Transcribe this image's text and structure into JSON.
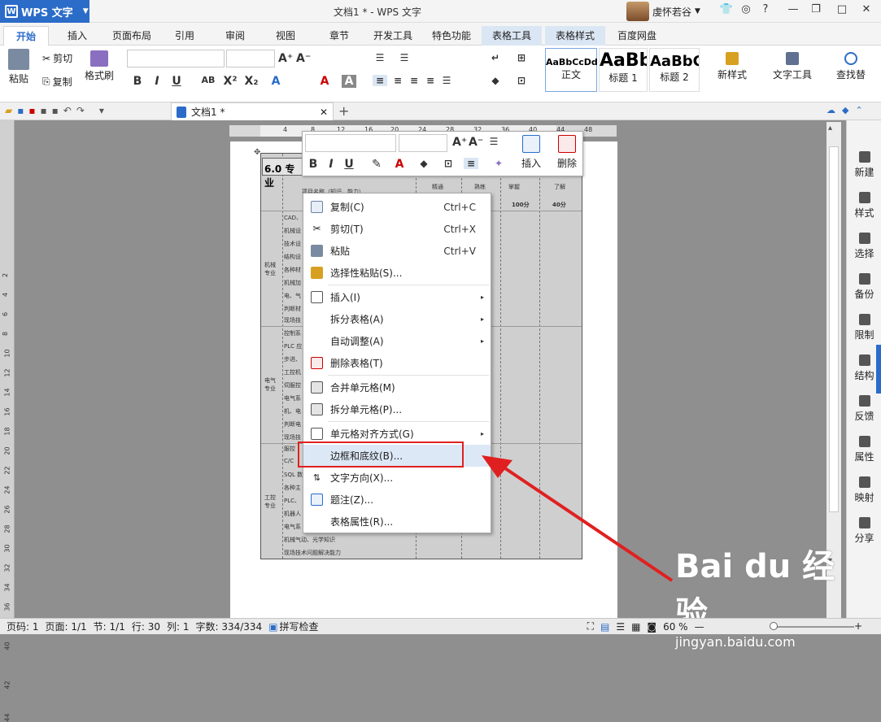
{
  "app": {
    "name": "WPS 文字",
    "title": "文档1 * - WPS 文字",
    "user": "虔怀若谷"
  },
  "tabs": [
    "开始",
    "插入",
    "页面布局",
    "引用",
    "审阅",
    "视图",
    "章节",
    "开发工具",
    "特色功能",
    "表格工具",
    "表格样式",
    "百度网盘"
  ],
  "ribbon": {
    "clipboard": {
      "paste": "粘贴",
      "cut": "剪切",
      "copy": "复制",
      "format_painter": "格式刷"
    },
    "styles": [
      {
        "preview": "AaBbCcDd",
        "label": "正文"
      },
      {
        "preview": "AaBb",
        "label": "标题 1"
      },
      {
        "preview": "AaBbC",
        "label": "标题 2"
      }
    ],
    "new_style": "新样式",
    "text_tools": "文字工具",
    "find_replace": "查找替"
  },
  "doc_tab": {
    "label": "文档1 *"
  },
  "ruler": {
    "h_marks": [
      "4",
      "8",
      "12",
      "16",
      "20",
      "24",
      "28",
      "32",
      "36",
      "40",
      "44",
      "48"
    ],
    "v_marks": [
      "2",
      "4",
      "6",
      "8",
      "10",
      "12",
      "14",
      "16",
      "18",
      "20",
      "22",
      "24",
      "26",
      "28",
      "30",
      "32",
      "34",
      "36",
      "38",
      "40",
      "42",
      "44"
    ]
  },
  "document": {
    "heading": "6.0 专业",
    "header_row": [
      "项目名称（知识、能力）",
      "精通",
      "熟练",
      "掌握",
      "了解"
    ],
    "score_row": [
      "100分",
      "40分"
    ],
    "groups": [
      {
        "name": "机械专业",
        "items": [
          "CAD、",
          "机械设",
          "技术设",
          "结构设",
          "各种材",
          "机械加",
          "电、气",
          "判断材",
          "现场技"
        ]
      },
      {
        "name": "电气专业",
        "items": [
          "控制系",
          "PLC 应",
          "步进、",
          "工控机",
          "伺服控",
          "电气系",
          "机、电",
          "判断电",
          "现场技"
        ]
      },
      {
        "name": "工控专业",
        "items": [
          "服控",
          "C/C",
          "SQL 数",
          "各种主",
          "PLC、",
          "机器人",
          "电气系",
          "机械气动、光学知识",
          "现场技术问题解决能力"
        ]
      }
    ]
  },
  "mini_toolbar": {
    "insert": "插入",
    "delete": "删除"
  },
  "context_menu": [
    {
      "label": "复制(C)",
      "shortcut": "Ctrl+C",
      "icon": "copy-icon"
    },
    {
      "label": "剪切(T)",
      "shortcut": "Ctrl+X",
      "icon": "scissors-icon"
    },
    {
      "label": "粘贴",
      "shortcut": "Ctrl+V",
      "icon": "paste-icon"
    },
    {
      "label": "选择性粘贴(S)...",
      "shortcut": "",
      "icon": "paste-special-icon"
    },
    {
      "label": "插入(I)",
      "shortcut": "",
      "icon": "table-icon",
      "submenu": true
    },
    {
      "label": "拆分表格(A)",
      "shortcut": "",
      "submenu": true
    },
    {
      "label": "自动调整(A)",
      "shortcut": "",
      "submenu": true
    },
    {
      "label": "删除表格(T)",
      "shortcut": "",
      "icon": "delete-table-icon"
    },
    {
      "label": "合并单元格(M)",
      "shortcut": "",
      "icon": "merge-cells-icon"
    },
    {
      "label": "拆分单元格(P)...",
      "shortcut": "",
      "icon": "split-cells-icon"
    },
    {
      "label": "单元格对齐方式(G)",
      "shortcut": "",
      "icon": "align-icon",
      "submenu": true
    },
    {
      "label": "边框和底纹(B)...",
      "shortcut": "",
      "highlighted": true
    },
    {
      "label": "文字方向(X)...",
      "shortcut": "",
      "icon": "text-direction-icon"
    },
    {
      "label": "题注(Z)...",
      "shortcut": "",
      "icon": "caption-icon"
    },
    {
      "label": "表格属性(R)...",
      "shortcut": ""
    }
  ],
  "right_panel": [
    "新建",
    "样式",
    "选择",
    "备份",
    "限制",
    "结构",
    "反馈",
    "属性",
    "映射",
    "分享"
  ],
  "status": {
    "page": "页码: 1",
    "pages": "页面: 1/1",
    "section": "节: 1/1",
    "row": "行: 30",
    "col": "列: 1",
    "words": "字数: 334/334",
    "spell": "拼写检查",
    "zoom": "60 %"
  },
  "watermark": {
    "brand": "Bai du 经验",
    "url": "jingyan.baidu.com"
  },
  "colors": {
    "accent": "#2b6cc9",
    "highlight": "#e02020",
    "menu_hover": "#dde8f6"
  }
}
